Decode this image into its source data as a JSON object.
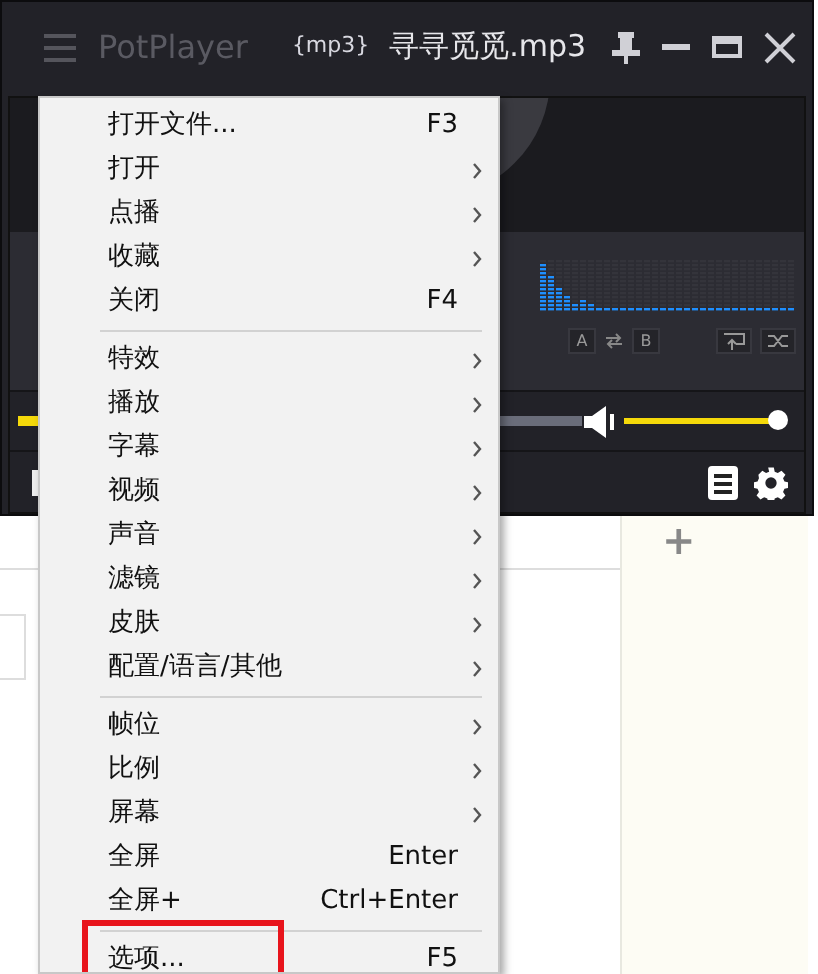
{
  "player": {
    "app_name": "PotPlayer",
    "format": "{mp3}",
    "file_name": "寻寻觅觅.mp3",
    "ab_buttons": [
      "A",
      "B"
    ],
    "seek": {
      "level": 0.3
    },
    "volume": {
      "level": 0.97
    }
  },
  "page": {
    "add_button": "+"
  },
  "context_menu": [
    {
      "kind": "item",
      "label": "打开文件...",
      "shortcut": "F3",
      "submenu": false,
      "highlighted": false
    },
    {
      "kind": "item",
      "label": "打开",
      "submenu": true,
      "highlighted": false
    },
    {
      "kind": "item",
      "label": "点播",
      "submenu": true,
      "highlighted": false
    },
    {
      "kind": "item",
      "label": "收藏",
      "submenu": true,
      "highlighted": false
    },
    {
      "kind": "item",
      "label": "关闭",
      "shortcut": "F4",
      "submenu": false,
      "highlighted": false
    },
    {
      "kind": "separator"
    },
    {
      "kind": "item",
      "label": "特效",
      "submenu": true,
      "highlighted": false
    },
    {
      "kind": "item",
      "label": "播放",
      "submenu": true,
      "highlighted": false
    },
    {
      "kind": "item",
      "label": "字幕",
      "submenu": true,
      "highlighted": false
    },
    {
      "kind": "item",
      "label": "视频",
      "submenu": true,
      "highlighted": false
    },
    {
      "kind": "item",
      "label": "声音",
      "submenu": true,
      "highlighted": false
    },
    {
      "kind": "item",
      "label": "滤镜",
      "submenu": true,
      "highlighted": false
    },
    {
      "kind": "item",
      "label": "皮肤",
      "submenu": true,
      "highlighted": false
    },
    {
      "kind": "item",
      "label": "配置/语言/其他",
      "submenu": true,
      "highlighted": false
    },
    {
      "kind": "separator"
    },
    {
      "kind": "item",
      "label": "帧位",
      "submenu": true,
      "highlighted": false
    },
    {
      "kind": "item",
      "label": "比例",
      "submenu": true,
      "highlighted": false
    },
    {
      "kind": "item",
      "label": "屏幕",
      "submenu": true,
      "highlighted": false
    },
    {
      "kind": "item",
      "label": "全屏",
      "shortcut": "Enter",
      "submenu": false,
      "highlighted": false
    },
    {
      "kind": "item",
      "label": "全屏+",
      "shortcut": "Ctrl+Enter",
      "submenu": false,
      "highlighted": false
    },
    {
      "kind": "separator"
    },
    {
      "kind": "item",
      "label": "选项...",
      "shortcut": "F5",
      "submenu": false,
      "highlighted": true
    }
  ]
}
